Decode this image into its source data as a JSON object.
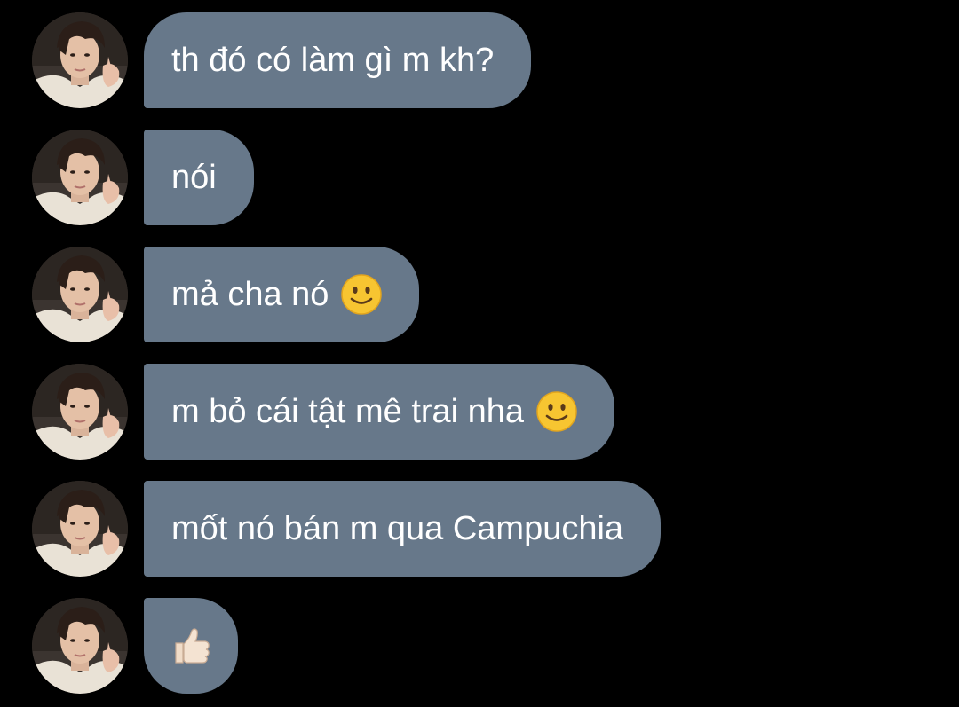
{
  "messages": [
    {
      "text": "th đó có làm gì m kh?",
      "emoji": ""
    },
    {
      "text": "nói",
      "emoji": ""
    },
    {
      "text": "mả cha nó",
      "emoji": "slightly-smiling-face-emoji"
    },
    {
      "text": "m bỏ cái tật mê trai nha",
      "emoji": "slightly-smiling-face-emoji"
    },
    {
      "text": "mốt nó bán m qua Campuchia",
      "emoji": ""
    },
    {
      "text": "",
      "emoji": "thumbs-up-emoji"
    }
  ],
  "colors": {
    "background": "#000000",
    "bubble": "#67788a",
    "text": "#ffffff"
  }
}
